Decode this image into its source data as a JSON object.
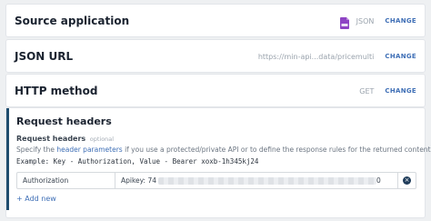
{
  "source_application": {
    "title": "Source application",
    "value": "JSON",
    "icon": "json-file-icon",
    "change": "CHANGE"
  },
  "json_url": {
    "title": "JSON URL",
    "value": "https://min-api...data/pricemulti",
    "change": "CHANGE"
  },
  "http_method": {
    "title": "HTTP method",
    "value": "GET",
    "change": "CHANGE"
  },
  "request_headers": {
    "title": "Request headers",
    "sub_label": "Request headers",
    "optional": "optional",
    "desc_before": "Specify the ",
    "desc_link": "header parameters",
    "desc_after": " if you use a protected/private API or to define the response rules for the returned content.",
    "example": "Example: Key - Authorization, Value - Bearer xoxb-1h345kj24",
    "rows": [
      {
        "key": "Authorization",
        "value_prefix": "Apikey: 74",
        "value_suffix": "0"
      }
    ],
    "add_new": "+ Add new"
  },
  "colors": {
    "accent": "#3f6fb6",
    "active_border": "#1f4d6e",
    "json_icon": "#8e44c4"
  }
}
